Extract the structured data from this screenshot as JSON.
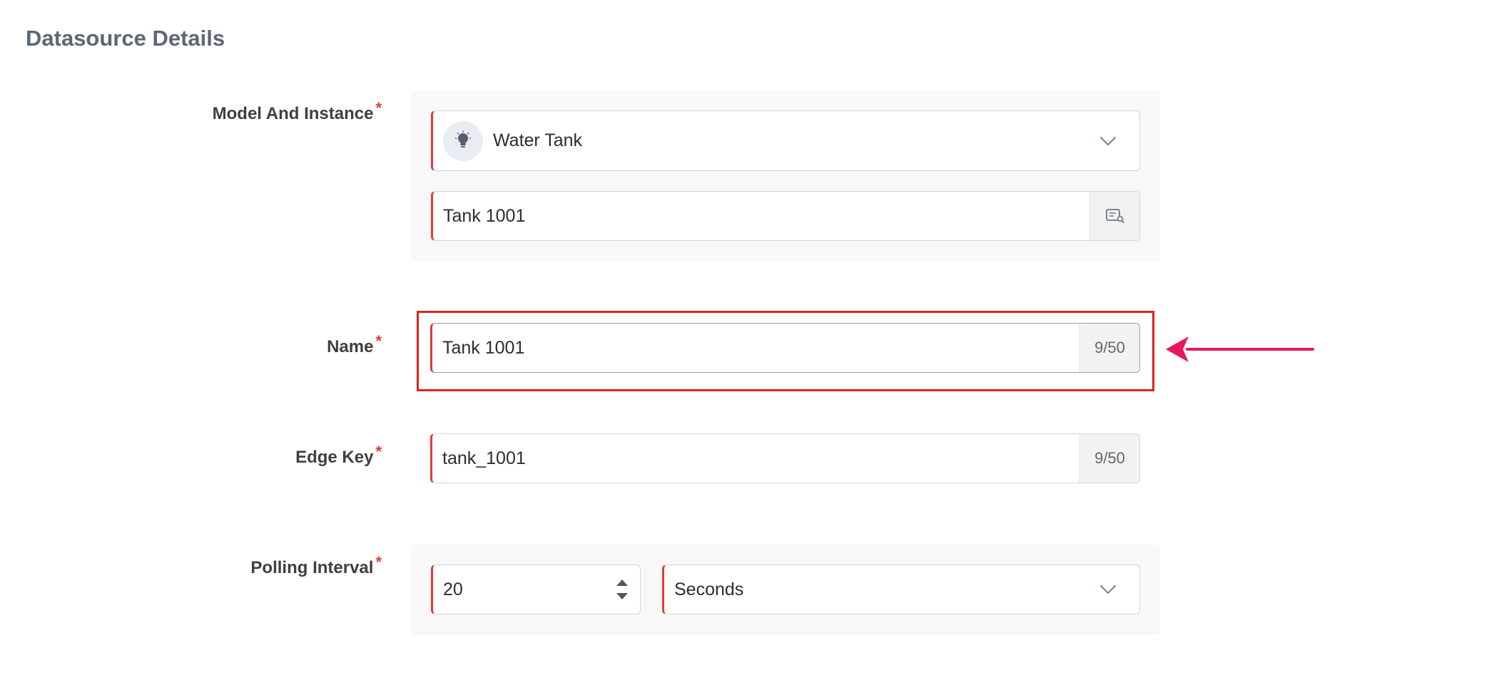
{
  "section": {
    "title": "Datasource Details"
  },
  "required_mark": "*",
  "model_and_instance": {
    "label": "Model And Instance",
    "model_value": "Water Tank",
    "model_icon": "lightbulb-icon",
    "instance_value": "Tank 1001",
    "instance_icon": "list-search-icon"
  },
  "name": {
    "label": "Name",
    "value": "Tank 1001",
    "counter": "9/50"
  },
  "edge_key": {
    "label": "Edge Key",
    "value": "tank_1001",
    "counter": "9/50"
  },
  "polling_interval": {
    "label": "Polling Interval",
    "value": "20",
    "unit": "Seconds"
  },
  "colors": {
    "required": "#e53935",
    "highlight": "#e02020",
    "arrow": "#e8175d"
  }
}
